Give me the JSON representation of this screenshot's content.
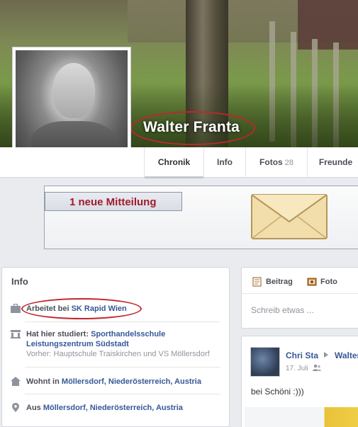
{
  "profile": {
    "name": "Walter Franta"
  },
  "nav": {
    "tabs": [
      {
        "label": "Chronik"
      },
      {
        "label": "Info"
      },
      {
        "label": "Fotos",
        "count": "28"
      },
      {
        "label": "Freunde"
      }
    ]
  },
  "banner": {
    "label": "1 neue Mitteilung"
  },
  "info": {
    "title": "Info",
    "work": {
      "prefix": "Arbeitet bei ",
      "link": "SK Rapid Wien"
    },
    "study": {
      "prefix": "Hat hier studiert: ",
      "link": "Sporthandelsschule Leistungszentrum Südstadt",
      "previous": "Vorher: Hauptschule Traiskirchen und VS Möllersdorf"
    },
    "lives": {
      "prefix": "Wohnt in ",
      "link": "Möllersdorf, Niederösterreich, Austria"
    },
    "from": {
      "prefix": "Aus ",
      "link": "Möllersdorf, Niederösterreich, Austria"
    }
  },
  "composer": {
    "tab_post": "Beitrag",
    "tab_photo": "Foto",
    "placeholder": "Schreib etwas ..."
  },
  "post": {
    "author": "Chri Sta",
    "target": "Walter",
    "date": "17. Juli",
    "text": "bei Schöni :)))"
  },
  "colors": {
    "link": "#365899",
    "highlight_oval": "#c0262c",
    "banner_text": "#a1192e"
  }
}
